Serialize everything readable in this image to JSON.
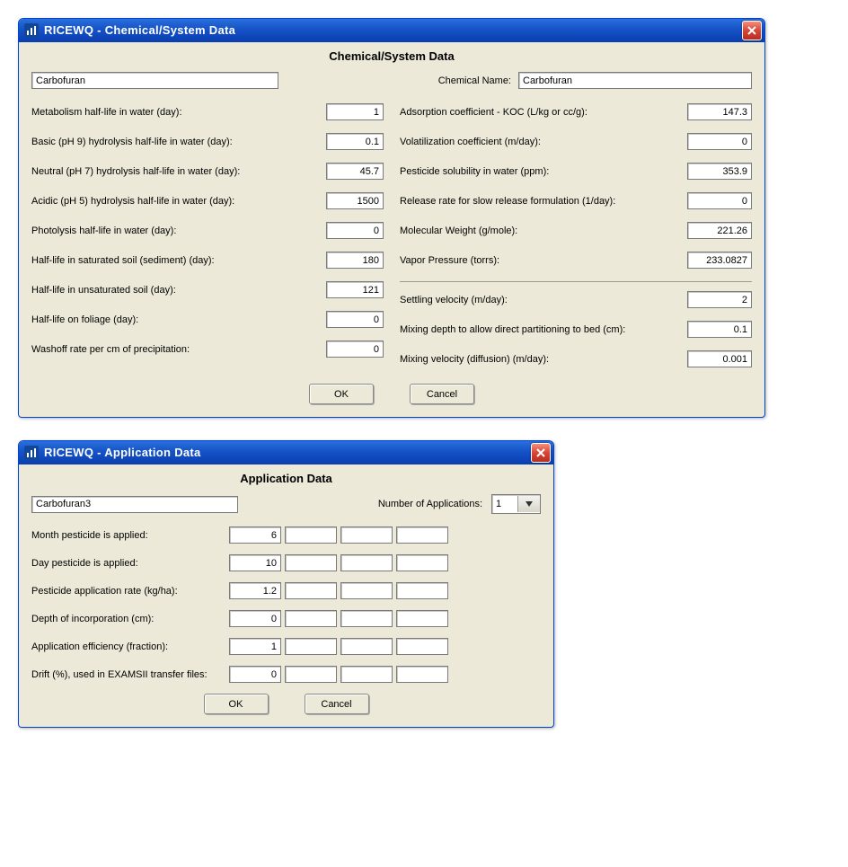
{
  "chem": {
    "window_title": "RICEWQ - Chemical/System Data",
    "heading": "Chemical/System Data",
    "name_input": "Carbofuran",
    "chem_name_label": "Chemical Name:",
    "chem_name_value": "Carbofuran",
    "left": [
      {
        "label": "Metabolism half-life in water (day):",
        "value": "1"
      },
      {
        "label": "Basic (pH 9) hydrolysis half-life in water (day):",
        "value": "0.1"
      },
      {
        "label": "Neutral (pH 7) hydrolysis half-life in water (day):",
        "value": "45.7"
      },
      {
        "label": "Acidic (pH 5) hydrolysis half-life in water (day):",
        "value": "1500"
      },
      {
        "label": "Photolysis half-life in water (day):",
        "value": "0"
      },
      {
        "label": "Half-life in saturated soil (sediment) (day):",
        "value": "180"
      },
      {
        "label": "Half-life in unsaturated soil (day):",
        "value": "121"
      },
      {
        "label": "Half-life on foliage (day):",
        "value": "0"
      },
      {
        "label": "Washoff rate per cm of precipitation:",
        "value": "0"
      }
    ],
    "right_a": [
      {
        "label": "Adsorption coefficient - KOC (L/kg or cc/g):",
        "value": "147.3"
      },
      {
        "label": "Volatilization coefficient (m/day):",
        "value": "0"
      },
      {
        "label": "Pesticide solubility in water (ppm):",
        "value": "353.9"
      },
      {
        "label": "Release rate for slow release formulation (1/day):",
        "value": "0"
      },
      {
        "label": "Molecular Weight (g/mole):",
        "value": "221.26"
      },
      {
        "label": "Vapor Pressure (torrs):",
        "value": "233.0827"
      }
    ],
    "right_b": [
      {
        "label": "Settling velocity (m/day):",
        "value": "2"
      },
      {
        "label": "Mixing depth to allow direct partitioning to bed (cm):",
        "value": "0.1"
      },
      {
        "label": "Mixing velocity (diffusion) (m/day):",
        "value": "0.001"
      }
    ],
    "ok": "OK",
    "cancel": "Cancel"
  },
  "app": {
    "window_title": "RICEWQ - Application Data",
    "heading": "Application Data",
    "name_input": "Carbofuran3",
    "num_apps_label": "Number of Applications:",
    "num_apps_value": "1",
    "rows": [
      {
        "label": "Month pesticide is applied:",
        "v": [
          "6",
          "",
          "",
          ""
        ]
      },
      {
        "label": "Day pesticide is applied:",
        "v": [
          "10",
          "",
          "",
          ""
        ]
      },
      {
        "label": "Pesticide application rate (kg/ha):",
        "v": [
          "1.2",
          "",
          "",
          ""
        ]
      },
      {
        "label": "Depth of incorporation (cm):",
        "v": [
          "0",
          "",
          "",
          ""
        ]
      },
      {
        "label": "Application efficiency (fraction):",
        "v": [
          "1",
          "",
          "",
          ""
        ]
      },
      {
        "label": "Drift (%), used in EXAMSII transfer files:",
        "v": [
          "0",
          "",
          "",
          ""
        ]
      }
    ],
    "ok": "OK",
    "cancel": "Cancel"
  }
}
